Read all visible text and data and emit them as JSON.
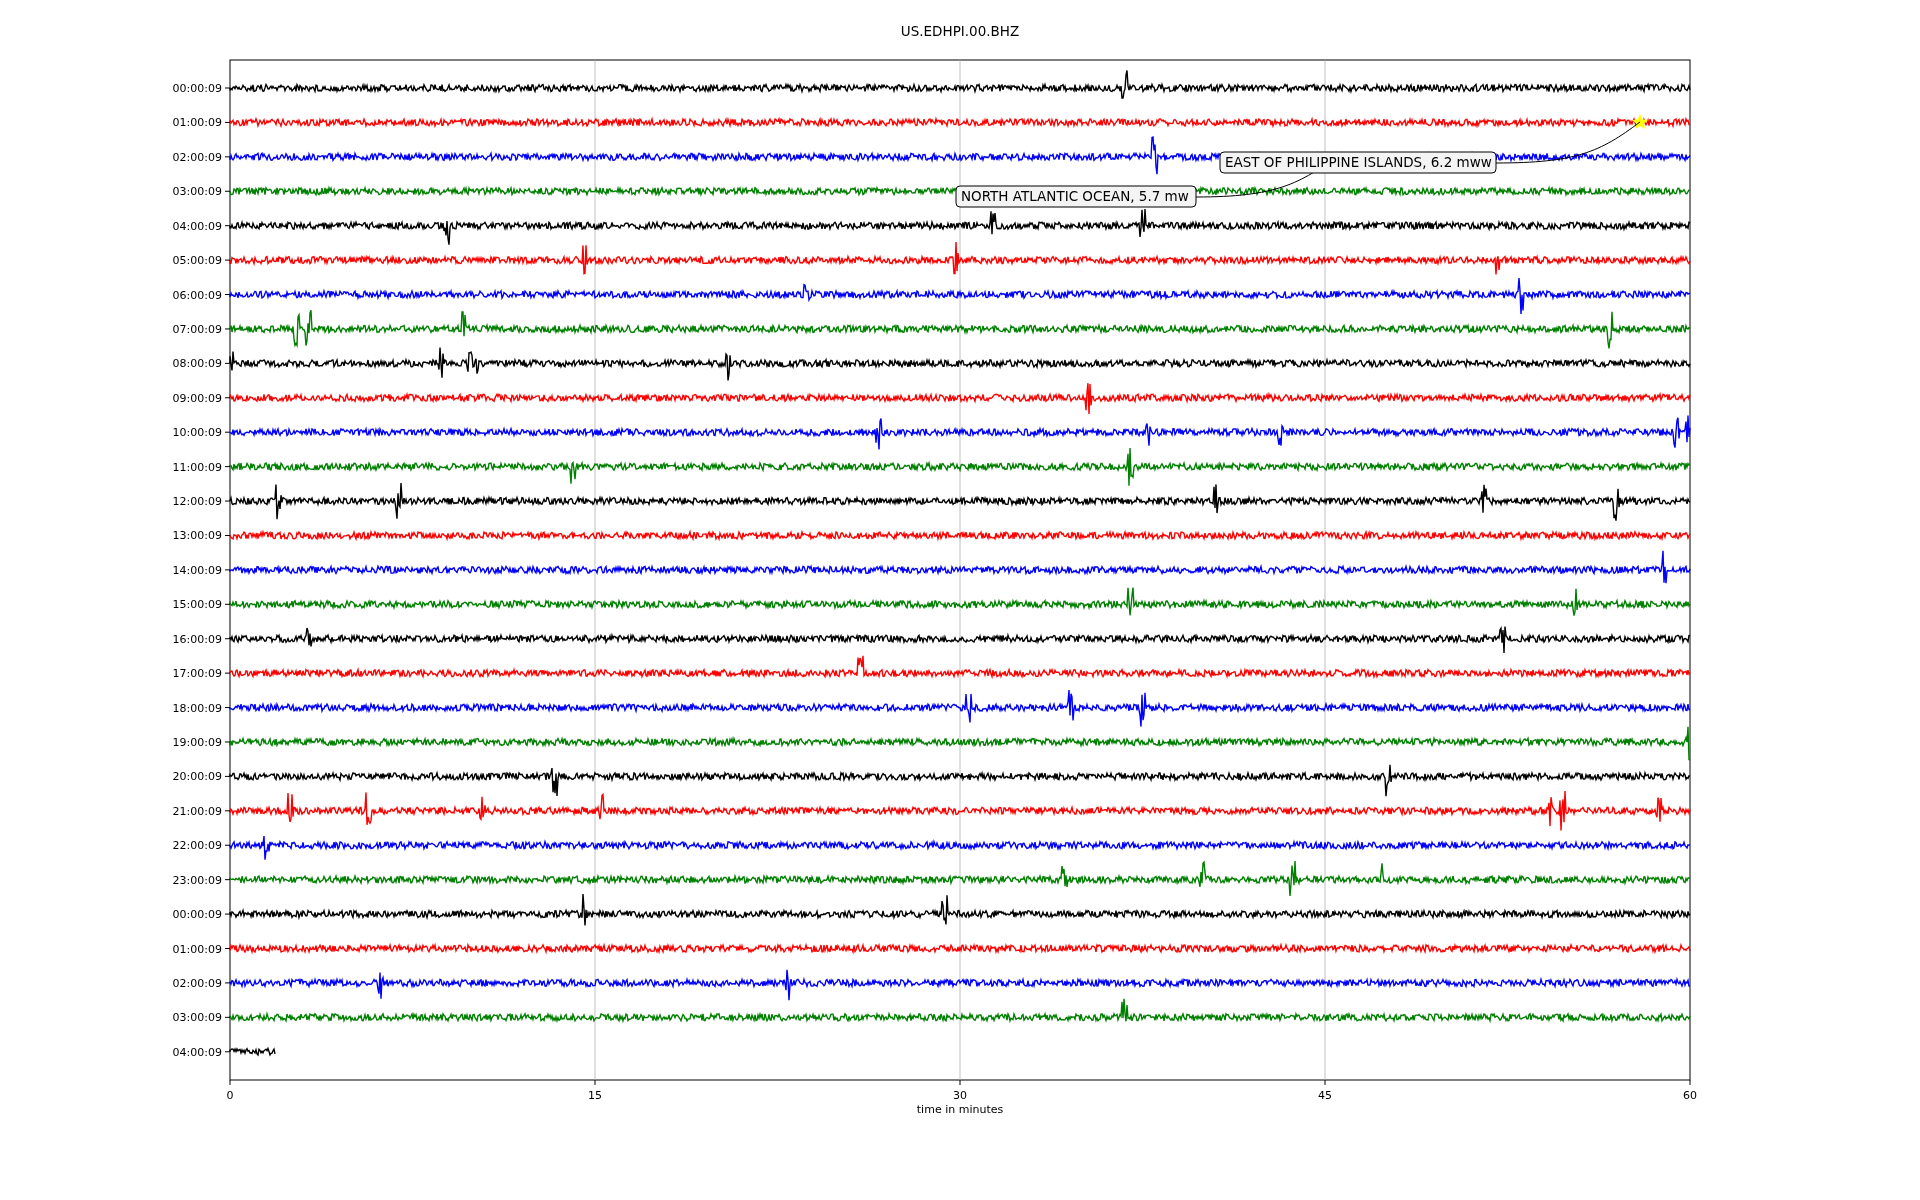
{
  "title": "US.EDHPI.00.BHZ",
  "traces": [
    {
      "label": "00:00:09",
      "color": "#000000",
      "kind": "full"
    },
    {
      "label": "01:00:09",
      "color": "#ff0000",
      "kind": "full"
    },
    {
      "label": "02:00:09",
      "color": "#0000ff",
      "kind": "full"
    },
    {
      "label": "03:00:09",
      "color": "#008000",
      "kind": "full"
    },
    {
      "label": "04:00:09",
      "color": "#000000",
      "kind": "full"
    },
    {
      "label": "05:00:09",
      "color": "#ff0000",
      "kind": "full"
    },
    {
      "label": "06:00:09",
      "color": "#0000ff",
      "kind": "full"
    },
    {
      "label": "07:00:09",
      "color": "#008000",
      "kind": "full"
    },
    {
      "label": "08:00:09",
      "color": "#000000",
      "kind": "full"
    },
    {
      "label": "09:00:09",
      "color": "#ff0000",
      "kind": "full"
    },
    {
      "label": "10:00:09",
      "color": "#0000ff",
      "kind": "full"
    },
    {
      "label": "11:00:09",
      "color": "#008000",
      "kind": "full"
    },
    {
      "label": "12:00:09",
      "color": "#000000",
      "kind": "full"
    },
    {
      "label": "13:00:09",
      "color": "#ff0000",
      "kind": "full"
    },
    {
      "label": "14:00:09",
      "color": "#0000ff",
      "kind": "full"
    },
    {
      "label": "15:00:09",
      "color": "#008000",
      "kind": "full"
    },
    {
      "label": "16:00:09",
      "color": "#000000",
      "kind": "full"
    },
    {
      "label": "17:00:09",
      "color": "#ff0000",
      "kind": "full"
    },
    {
      "label": "18:00:09",
      "color": "#0000ff",
      "kind": "full"
    },
    {
      "label": "19:00:09",
      "color": "#008000",
      "kind": "full"
    },
    {
      "label": "20:00:09",
      "color": "#000000",
      "kind": "full"
    },
    {
      "label": "21:00:09",
      "color": "#ff0000",
      "kind": "full"
    },
    {
      "label": "22:00:09",
      "color": "#0000ff",
      "kind": "full"
    },
    {
      "label": "23:00:09",
      "color": "#008000",
      "kind": "full"
    },
    {
      "label": "00:00:09",
      "color": "#000000",
      "kind": "full"
    },
    {
      "label": "01:00:09",
      "color": "#ff0000",
      "kind": "full"
    },
    {
      "label": "02:00:09",
      "color": "#0000ff",
      "kind": "full"
    },
    {
      "label": "03:00:09",
      "color": "#008000",
      "kind": "full"
    },
    {
      "label": "04:00:09",
      "color": "#000000",
      "kind": "partial"
    }
  ],
  "x_axis": {
    "ticks": [
      "0",
      "15",
      "30",
      "45",
      "60"
    ],
    "label": "time in minutes"
  },
  "annotations": [
    {
      "text": "EAST OF PHILIPPINE ISLANDS, 6.2 mww"
    },
    {
      "text": "NORTH ATLANTIC OCEAN, 5.7 mw"
    }
  ]
}
